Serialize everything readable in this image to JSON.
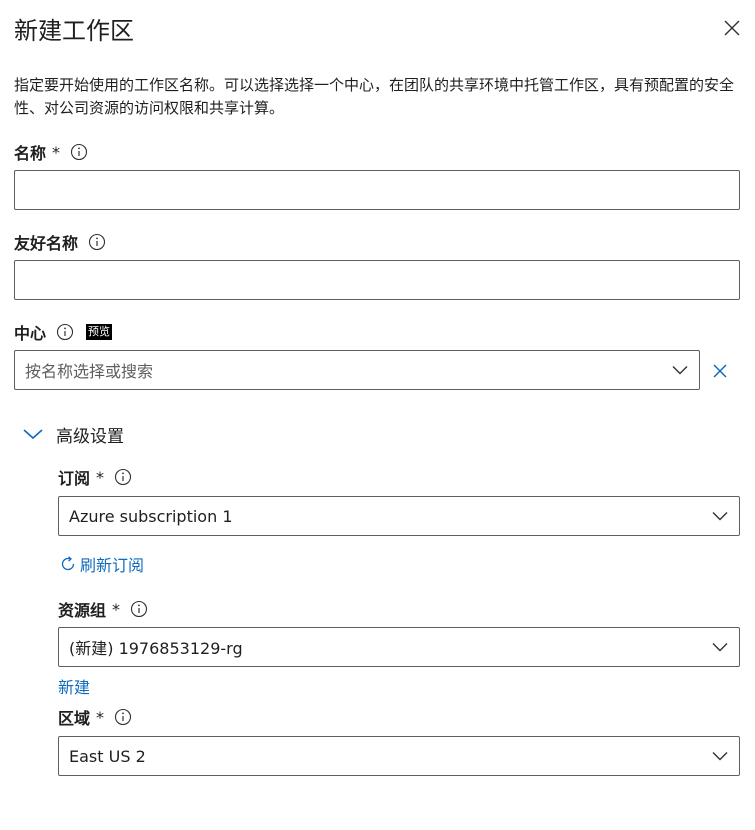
{
  "panel": {
    "title": "新建工作区",
    "description": "指定要开始使用的工作区名称。可以选择选择一个中心，在团队的共享环境中托管工作区，具有预配置的安全性、对公司资源的访问权限和共享计算。"
  },
  "fields": {
    "name": {
      "label": "名称",
      "required": "*",
      "value": ""
    },
    "friendly_name": {
      "label": "友好名称",
      "value": ""
    },
    "hub": {
      "label": "中心",
      "badge": "预览",
      "placeholder": "按名称选择或搜索"
    }
  },
  "advanced": {
    "label": "高级设置",
    "subscription": {
      "label": "订阅",
      "required": "*",
      "value": "Azure subscription 1",
      "refresh_label": "刷新订阅"
    },
    "resource_group": {
      "label": "资源组",
      "required": "*",
      "value": "(新建) 1976853129-rg",
      "new_label": "新建"
    },
    "region": {
      "label": "区域",
      "required": "*",
      "value": "East US 2"
    }
  },
  "icons": {
    "close": "close-icon",
    "info": "info-icon",
    "chevron_down": "chevron-down-icon",
    "clear": "clear-icon",
    "refresh": "refresh-icon"
  },
  "colors": {
    "link": "#0f6cbd",
    "border": "#605e5c",
    "text": "#201f1e"
  }
}
